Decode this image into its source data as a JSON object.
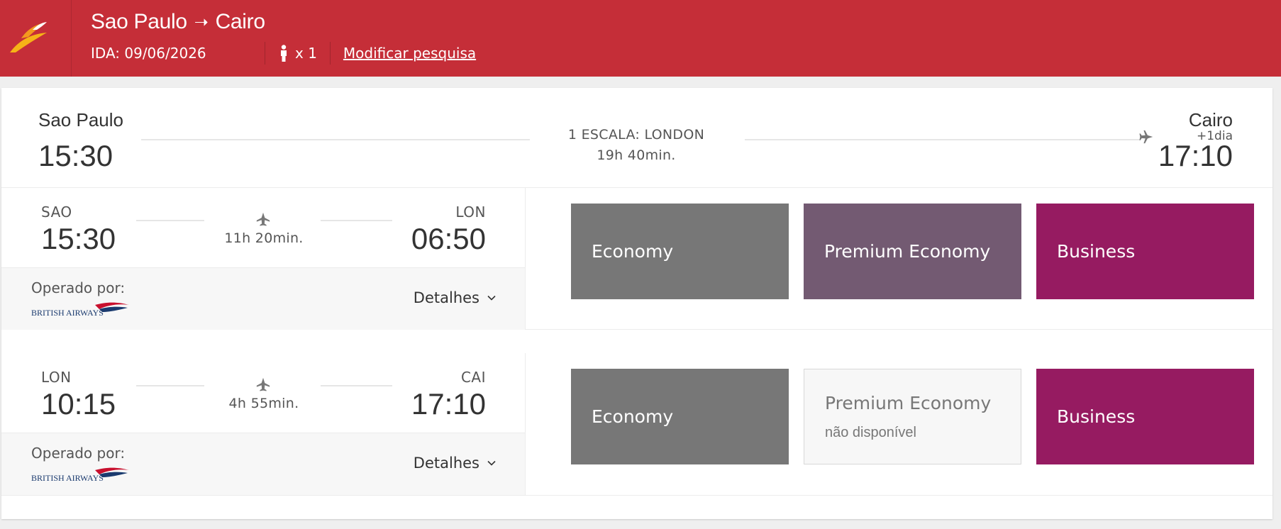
{
  "header": {
    "origin": "Sao Paulo",
    "arrow": "➝",
    "destination": "Cairo",
    "ida": "IDA: 09/06/2026",
    "passengers": "x 1",
    "modify_label": "Modificar pesquisa"
  },
  "summary": {
    "from_city": "Sao Paulo",
    "from_time": "15:30",
    "stops": "1 ESCALA: LONDON",
    "total_duration": "19h 40min.",
    "to_city": "Cairo",
    "plus_day": "+1dia",
    "to_time": "17:10"
  },
  "segments": [
    {
      "dep_code": "SAO",
      "dep_time": "15:30",
      "duration": "11h 20min.",
      "arr_code": "LON",
      "arr_time": "06:50",
      "operated_label": "Operado por:",
      "airline_logo_text": "BRITISH AIRWAYS",
      "details_label": "Detalhes",
      "fares": {
        "economy": "Economy",
        "premium": "Premium Economy",
        "business": "Business"
      }
    },
    {
      "dep_code": "LON",
      "dep_time": "10:15",
      "duration": "4h 55min.",
      "arr_code": "CAI",
      "arr_time": "17:10",
      "operated_label": "Operado por:",
      "airline_logo_text": "BRITISH AIRWAYS",
      "details_label": "Detalhes",
      "fares": {
        "economy": "Economy",
        "premium": "Premium Economy",
        "premium_note": "não disponível",
        "business": "Business"
      }
    }
  ],
  "colors": {
    "header": "#c52e38",
    "economy": "#777777",
    "premium": "#735a72",
    "business": "#961b61"
  },
  "icons": [
    "airline-logo-icon",
    "person-icon",
    "plane-icon",
    "chevron-down-icon",
    "british-airways-logo"
  ]
}
